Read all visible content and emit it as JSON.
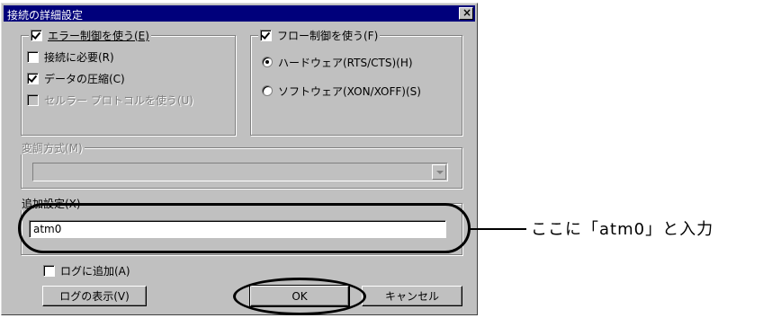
{
  "dialog": {
    "title": "接続の詳細設定",
    "close_glyph": "×"
  },
  "error_group": {
    "legend": "エラー制御を使う(E)",
    "checked": true,
    "options": [
      {
        "label": "接続に必要(R)",
        "checked": false,
        "disabled": false
      },
      {
        "label": "データの圧縮(C)",
        "checked": true,
        "disabled": false
      },
      {
        "label": "セルラー プロトコルを使う(U)",
        "checked": false,
        "disabled": true
      }
    ]
  },
  "flow_group": {
    "legend": "フロー制御を使う(F)",
    "checked": true,
    "options": [
      {
        "label": "ハードウェア(RTS/CTS)(H)",
        "selected": true
      },
      {
        "label": "ソフトウェア(XON/XOFF)(S)",
        "selected": false
      }
    ]
  },
  "modulation": {
    "legend": "変調方式(M)",
    "value": "",
    "disabled": true
  },
  "extra_settings": {
    "legend": "追加設定(X)",
    "value": "atm0"
  },
  "log_checkbox": {
    "label": "ログに追加(A)",
    "checked": false
  },
  "buttons": {
    "show_log": "ログの表示(V)",
    "ok": "OK",
    "cancel": "キャンセル"
  },
  "annotation": {
    "callout_text": "ここに「atm0」と入力"
  }
}
